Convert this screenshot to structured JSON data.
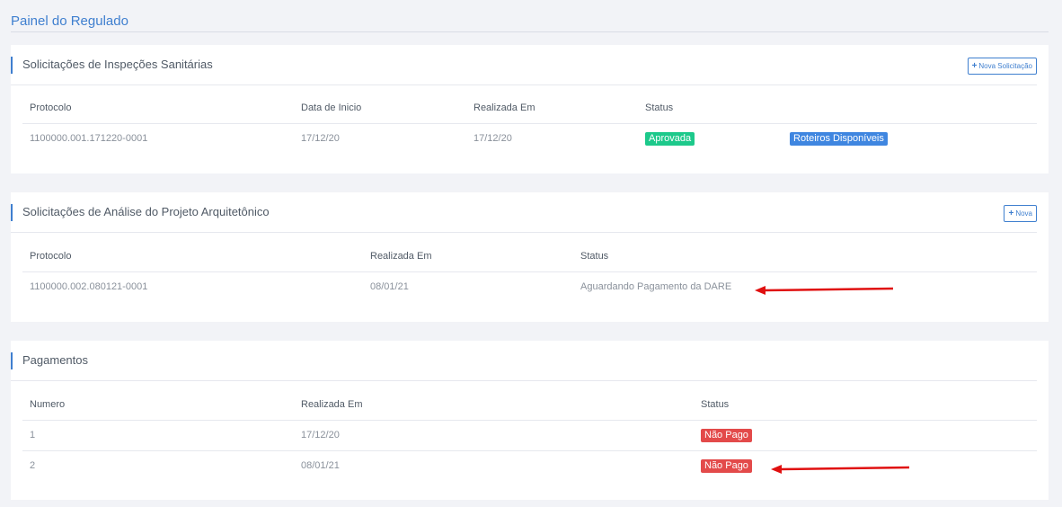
{
  "page": {
    "title": "Painel do Regulado"
  },
  "inspections": {
    "title": "Solicitações de Inspeções Sanitárias",
    "new_button": "Nova Solicitação",
    "headers": [
      "Protocolo",
      "Data de Inicio",
      "Realizada Em",
      "Status"
    ],
    "rows": [
      {
        "protocolo": "1100000.001.171220-0001",
        "inicio": "17/12/20",
        "realizada": "17/12/20",
        "status": "Aprovada",
        "action": "Roteiros Disponíveis"
      }
    ]
  },
  "projects": {
    "title": "Solicitações de Análise do Projeto Arquitetônico",
    "new_button": "Nova",
    "headers": [
      "Protocolo",
      "Realizada Em",
      "Status"
    ],
    "rows": [
      {
        "protocolo": "1100000.002.080121-0001",
        "realizada": "08/01/21",
        "status": "Aguardando Pagamento da DARE"
      }
    ]
  },
  "payments": {
    "title": "Pagamentos",
    "headers": [
      "Numero",
      "Realizada Em",
      "Status"
    ],
    "rows": [
      {
        "numero": "1",
        "realizada": "17/12/20",
        "status": "Não Pago"
      },
      {
        "numero": "2",
        "realizada": "08/01/21",
        "status": "Não Pago"
      }
    ]
  },
  "colors": {
    "accent": "#3f7fcf",
    "approved": "#1dc98b",
    "info": "#3f86e0",
    "unpaid": "#e34a4a",
    "annotation_arrow": "#e01010"
  }
}
